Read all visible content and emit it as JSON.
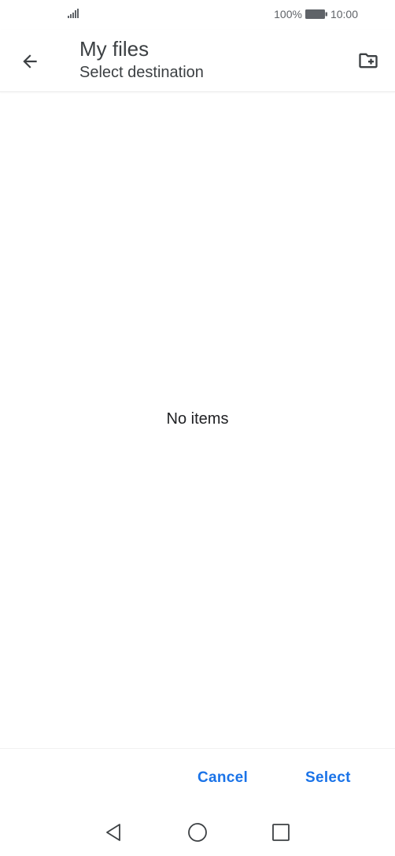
{
  "status_bar": {
    "battery_percent": "100%",
    "time": "10:00",
    "signal_icon": "signal-icon",
    "battery_icon": "battery-icon"
  },
  "app_bar": {
    "title": "My files",
    "subtitle": "Select destination",
    "back_icon": "arrow-back-icon",
    "new_folder_icon": "create-new-folder-icon"
  },
  "content": {
    "empty_message": "No items"
  },
  "actions": {
    "cancel_label": "Cancel",
    "select_label": "Select",
    "accent_color": "#1a73e8"
  },
  "nav_bar": {
    "back_icon": "nav-back-icon",
    "home_icon": "nav-home-icon",
    "recents_icon": "nav-recents-icon"
  }
}
